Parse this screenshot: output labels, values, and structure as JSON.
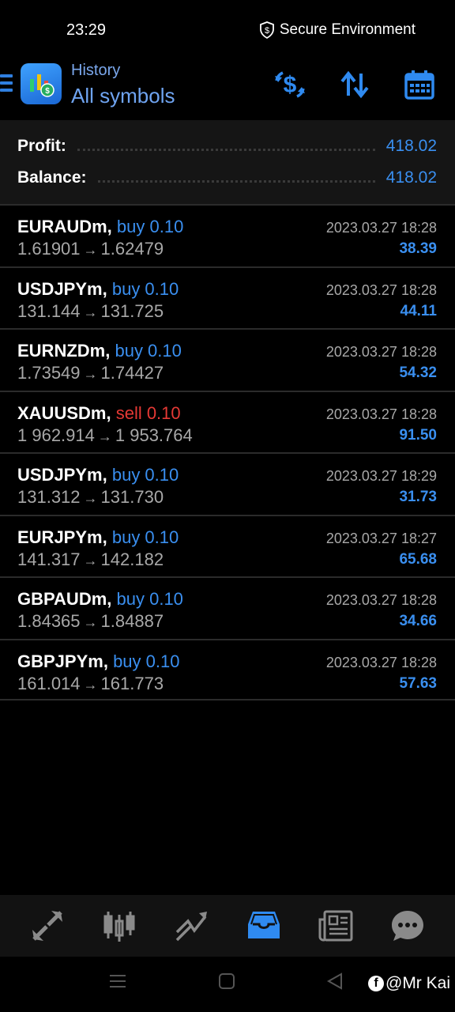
{
  "status_bar": {
    "time": "23:29",
    "secure_label": "Secure Environment"
  },
  "header": {
    "subtitle": "History",
    "title": "All symbols",
    "actions": [
      "dollar-exchange-icon",
      "sort-icon",
      "calendar-icon"
    ]
  },
  "summary": {
    "profit_label": "Profit:",
    "profit_value": "418.02",
    "balance_label": "Balance:",
    "balance_value": "418.02"
  },
  "trades": [
    {
      "symbol": "EURAUDm,",
      "side": "buy 0.10",
      "type": "buy",
      "open": "1.61901",
      "close": "1.62479",
      "time": "2023.03.27 18:28",
      "profit": "38.39"
    },
    {
      "symbol": "USDJPYm,",
      "side": "buy 0.10",
      "type": "buy",
      "open": "131.144",
      "close": "131.725",
      "time": "2023.03.27 18:28",
      "profit": "44.11"
    },
    {
      "symbol": "EURNZDm,",
      "side": "buy 0.10",
      "type": "buy",
      "open": "1.73549",
      "close": "1.74427",
      "time": "2023.03.27 18:28",
      "profit": "54.32"
    },
    {
      "symbol": "XAUUSDm,",
      "side": "sell 0.10",
      "type": "sell",
      "open": "1 962.914",
      "close": "1 953.764",
      "time": "2023.03.27 18:28",
      "profit": "91.50"
    },
    {
      "symbol": "USDJPYm,",
      "side": "buy 0.10",
      "type": "buy",
      "open": "131.312",
      "close": "131.730",
      "time": "2023.03.27 18:29",
      "profit": "31.73"
    },
    {
      "symbol": "EURJPYm,",
      "side": "buy 0.10",
      "type": "buy",
      "open": "141.317",
      "close": "142.182",
      "time": "2023.03.27 18:27",
      "profit": "65.68"
    },
    {
      "symbol": "GBPAUDm,",
      "side": "buy 0.10",
      "type": "buy",
      "open": "1.84365",
      "close": "1.84887",
      "time": "2023.03.27 18:28",
      "profit": "34.66"
    },
    {
      "symbol": "GBPJPYm,",
      "side": "buy 0.10",
      "type": "buy",
      "open": "161.014",
      "close": "161.773",
      "time": "2023.03.27 18:28",
      "profit": "57.63"
    }
  ],
  "bottom_nav": {
    "items": [
      "quotes-icon",
      "chart-icon",
      "trade-icon",
      "history-icon",
      "news-icon",
      "chat-icon"
    ],
    "active": "history-icon"
  },
  "watermark": {
    "text": "@Mr Kai"
  },
  "colors": {
    "accent": "#3a8ff0",
    "sell": "#e53935",
    "muted": "#a8a8a8"
  }
}
